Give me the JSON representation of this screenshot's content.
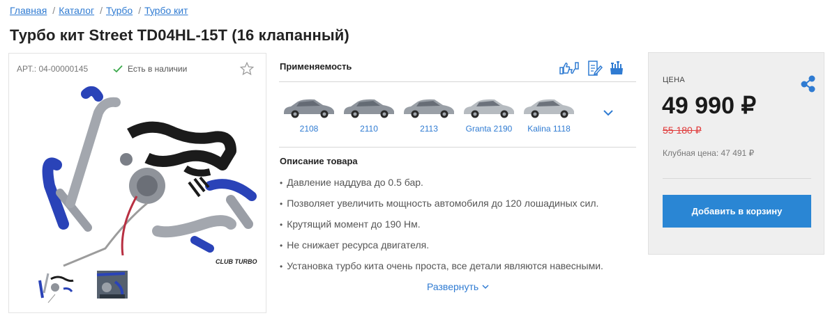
{
  "breadcrumb": {
    "items": [
      "Главная",
      "Каталог",
      "Турбо",
      "Турбо кит"
    ],
    "separator": "/"
  },
  "product": {
    "title": "Турбо кит Street TD04HL-15T (16 клапанный)",
    "sku": "АРТ.: 04-00000145",
    "stock": "Есть в наличии",
    "main_image_icon": "turbo-kit-photo",
    "thumbnails": [
      "turbo-kit-thumb",
      "engine-thumb"
    ],
    "watermark": "CLUB TURBO"
  },
  "applicability": {
    "title": "Применяемость",
    "icons": [
      "thumbs-compare-icon",
      "edit-doc-icon",
      "install-kit-icon"
    ],
    "cars": [
      {
        "label": "2108",
        "color": "#8a9099"
      },
      {
        "label": "2110",
        "color": "#8e949c"
      },
      {
        "label": "2113",
        "color": "#9aa0a7"
      },
      {
        "label": "Granta 2190",
        "color": "#b6bbc0"
      },
      {
        "label": "Kalina 1118",
        "color": "#b8bdc2"
      }
    ]
  },
  "description": {
    "title": "Описание товара",
    "items": [
      "Давление наддува до 0.5 бар.",
      "Позволяет увеличить мощность автомобиля до 120 лошадиных сил.",
      "Крутящий момент до 190 Нм.",
      "Не снижает ресурса двигателя.",
      "Установка турбо кита очень проста, все детали являются навесными."
    ],
    "more_label": "Развернуть"
  },
  "price": {
    "label": "ЦЕНА",
    "current": "49 990 ₽",
    "old": "55 180 ₽",
    "club": "Клубная цена: 47 491 ₽",
    "add_to_cart": "Добавить в корзину"
  },
  "colors": {
    "accent": "#2f7bd2",
    "button": "#2a86d4",
    "old_price": "#e03b3b",
    "in_stock": "#3aa84a"
  }
}
